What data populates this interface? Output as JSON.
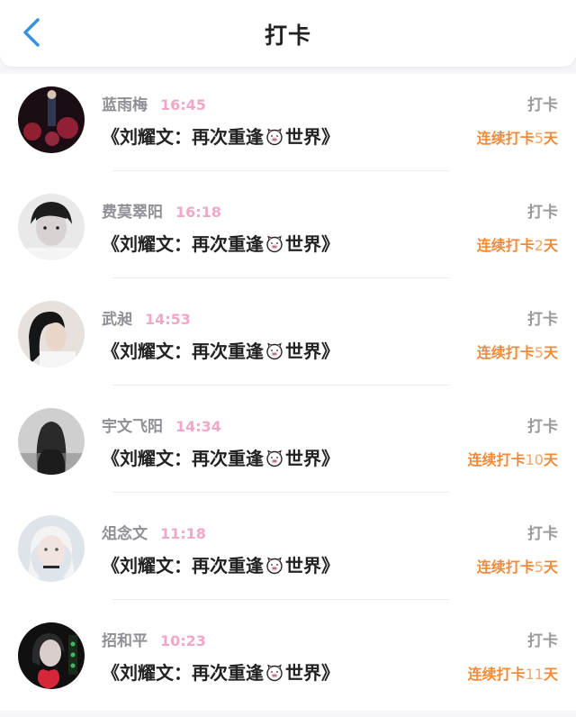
{
  "header": {
    "title": "打卡",
    "back_icon": "chevron-left-icon",
    "accent": "#3a8ee6"
  },
  "colors": {
    "name": "#8f8f96",
    "time": "#f0a7c9",
    "streak": "#f08a3a"
  },
  "items": [
    {
      "name": "蓝雨梅",
      "time": "16:45",
      "book": [
        "《刘耀文：再次重逢",
        "世界》"
      ],
      "type": "打卡",
      "streak_prefix": "连续打卡",
      "streak_num": "5",
      "streak_suffix": "天"
    },
    {
      "name": "费莫翠阳",
      "time": "16:18",
      "book": [
        "《刘耀文：再次重逢",
        "世界》"
      ],
      "type": "打卡",
      "streak_prefix": "连续打卡",
      "streak_num": "2",
      "streak_suffix": "天"
    },
    {
      "name": "武昶",
      "time": "14:53",
      "book": [
        "《刘耀文：再次重逢",
        "世界》"
      ],
      "type": "打卡",
      "streak_prefix": "连续打卡",
      "streak_num": "5",
      "streak_suffix": "天"
    },
    {
      "name": "宇文飞阳",
      "time": "14:34",
      "book": [
        "《刘耀文：再次重逢",
        "世界》"
      ],
      "type": "打卡",
      "streak_prefix": "连续打卡",
      "streak_num": "10",
      "streak_suffix": "天"
    },
    {
      "name": "俎念文",
      "time": "11:18",
      "book": [
        "《刘耀文：再次重逢",
        "世界》"
      ],
      "type": "打卡",
      "streak_prefix": "连续打卡",
      "streak_num": "5",
      "streak_suffix": "天"
    },
    {
      "name": "招和平",
      "time": "10:23",
      "book": [
        "《刘耀文：再次重逢",
        "世界》"
      ],
      "type": "打卡",
      "streak_prefix": "连续打卡",
      "streak_num": "11",
      "streak_suffix": "天"
    }
  ]
}
